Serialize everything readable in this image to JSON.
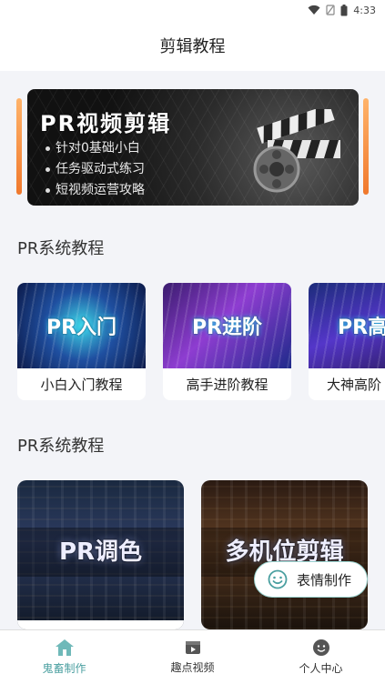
{
  "status_bar": {
    "time": "4:33",
    "icons": [
      "wifi-icon",
      "sim-icon",
      "battery-icon"
    ]
  },
  "header": {
    "title": "剪辑教程"
  },
  "banner": {
    "title": "PR视频剪辑",
    "lines": [
      "针对0基础小白",
      "任务驱动式练习",
      "短视频运营攻略"
    ]
  },
  "section1": {
    "title": "PR系统教程",
    "cards": [
      {
        "thumb_text": "PR入门",
        "caption": "小白入门教程"
      },
      {
        "thumb_text": "PR进阶",
        "caption": "高手进阶教程"
      },
      {
        "thumb_text": "PR高",
        "caption": "大神高阶"
      }
    ]
  },
  "section2": {
    "title": "PR系统教程",
    "cards": [
      {
        "thumb_text": "PR调色"
      },
      {
        "thumb_text": "多机位剪辑"
      }
    ]
  },
  "float_button": {
    "label": "表情制作",
    "icon": "smiley-icon"
  },
  "bottom_nav": {
    "items": [
      {
        "label": "鬼畜制作",
        "icon": "home-icon",
        "active": true
      },
      {
        "label": "趣点视频",
        "icon": "video-icon",
        "active": false
      },
      {
        "label": "个人中心",
        "icon": "face-icon",
        "active": false
      }
    ]
  },
  "colors": {
    "accent": "#4a9fa0",
    "banner_side": "#f0782c",
    "background": "#f3f4f8"
  }
}
